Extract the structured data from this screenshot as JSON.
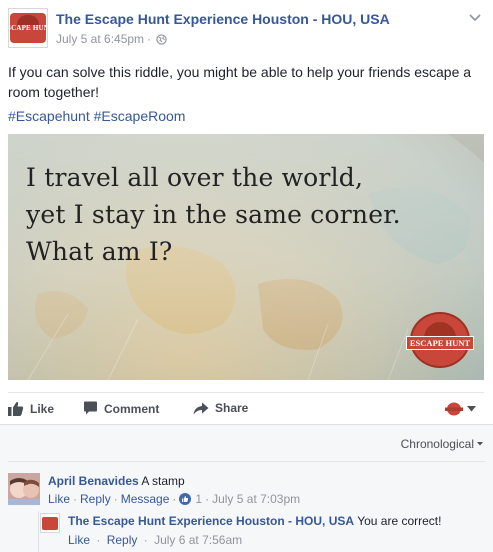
{
  "post": {
    "page_name": "The Escape Hunt Experience Houston - HOU, USA",
    "timestamp": "July 5 at 6:45pm",
    "meta_separator": "·",
    "privacy_icon": "globe-icon",
    "text": "If you can solve this riddle, you might be able to help your friends escape a room together!",
    "hashtags": [
      "#Escapehunt",
      "#EscapeRoom"
    ],
    "logo_text": "ESCAPE HUNT"
  },
  "media": {
    "riddle_lines": [
      "I travel all over the world,",
      "yet I stay in the same corner.",
      "What am I?"
    ],
    "logo_text": "ESCAPE HUNT"
  },
  "actions": {
    "like": "Like",
    "comment": "Comment",
    "share": "Share",
    "reaction_icon": "page-avatar-selector"
  },
  "comments": {
    "sort_label": "Chronological",
    "items": [
      {
        "author": "April Benavides",
        "text": "A stamp",
        "like": "Like",
        "reply": "Reply",
        "message": "Message",
        "like_count": "1",
        "time": "July 5 at 7:03pm"
      }
    ],
    "reply": {
      "author": "The Escape Hunt Experience Houston - HOU, USA",
      "text": "You are correct!",
      "like": "Like",
      "reply": "Reply",
      "time": "July 6 at 7:56am"
    }
  },
  "colors": {
    "link": "#365899",
    "meta": "#90949c",
    "brand": "#c8473a"
  }
}
